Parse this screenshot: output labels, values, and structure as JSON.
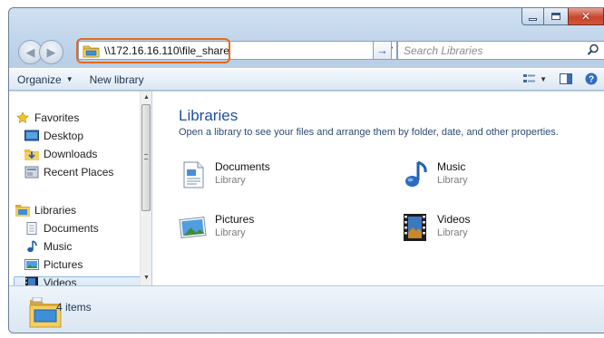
{
  "window": {
    "caption_buttons": [
      "minimize",
      "maximize",
      "close"
    ]
  },
  "address": {
    "path": "\\\\172.16.16.110\\file_share",
    "highlight_color": "#e56a1e"
  },
  "search": {
    "placeholder": "Search Libraries"
  },
  "toolbar": {
    "organize": "Organize",
    "new_library": "New library"
  },
  "nav": {
    "favorites": "Favorites",
    "fav_items": [
      "Desktop",
      "Downloads",
      "Recent Places"
    ],
    "libraries": "Libraries",
    "lib_items": [
      "Documents",
      "Music",
      "Pictures",
      "Videos"
    ]
  },
  "main": {
    "title": "Libraries",
    "subtitle": "Open a library to see your files and arrange them by folder, date, and other properties.",
    "items": [
      {
        "name": "Documents",
        "type": "Library",
        "icon": "documents-library-icon"
      },
      {
        "name": "Music",
        "type": "Library",
        "icon": "music-library-icon"
      },
      {
        "name": "Pictures",
        "type": "Library",
        "icon": "pictures-library-icon"
      },
      {
        "name": "Videos",
        "type": "Library",
        "icon": "videos-library-icon"
      }
    ]
  },
  "status": {
    "count": "4 items"
  }
}
